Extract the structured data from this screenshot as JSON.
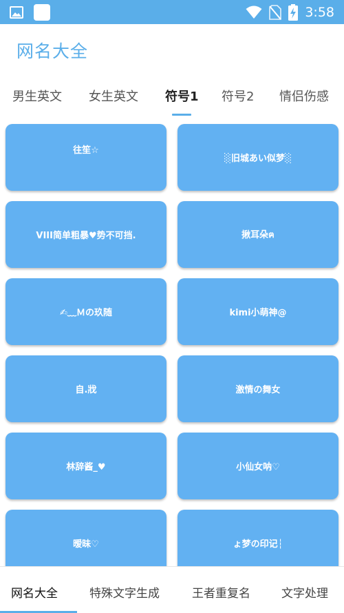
{
  "status_bar": {
    "time": "3:58",
    "icons": [
      "image-icon",
      "app-square-icon",
      "wifi-icon",
      "no-sim-icon",
      "battery-charging-icon"
    ]
  },
  "header": {
    "title": "网名大全"
  },
  "tabs": [
    {
      "label": "男生英文",
      "active": false
    },
    {
      "label": "女生英文",
      "active": false
    },
    {
      "label": "符号1",
      "active": true
    },
    {
      "label": "符号2",
      "active": false
    },
    {
      "label": "情侣伤感",
      "active": false
    }
  ],
  "cards": [
    {
      "text": "往笙☆"
    },
    {
      "text": "░旧城あい似梦░"
    },
    {
      "text": "VIII简单粗暴♥势不可挡."
    },
    {
      "text": "揪耳朵ฅ"
    },
    {
      "text": "✍﹏Ｍの玖随"
    },
    {
      "text": "kimi小萌神@"
    },
    {
      "text": "自.戕"
    },
    {
      "text": "激情の舞女"
    },
    {
      "text": "林辞酱_♥"
    },
    {
      "text": "小仙女呐♡"
    },
    {
      "text": "暧昧♡"
    },
    {
      "text": "ょ梦の印记┆"
    }
  ],
  "bottom_nav": [
    {
      "label": "网名大全",
      "active": true
    },
    {
      "label": "特殊文字生成",
      "active": false
    },
    {
      "label": "王者重复名",
      "active": false
    },
    {
      "label": "文字处理",
      "active": false
    }
  ],
  "colors": {
    "accent": "#5aaee9",
    "card": "#62b1f2",
    "text_dark": "#222222"
  }
}
